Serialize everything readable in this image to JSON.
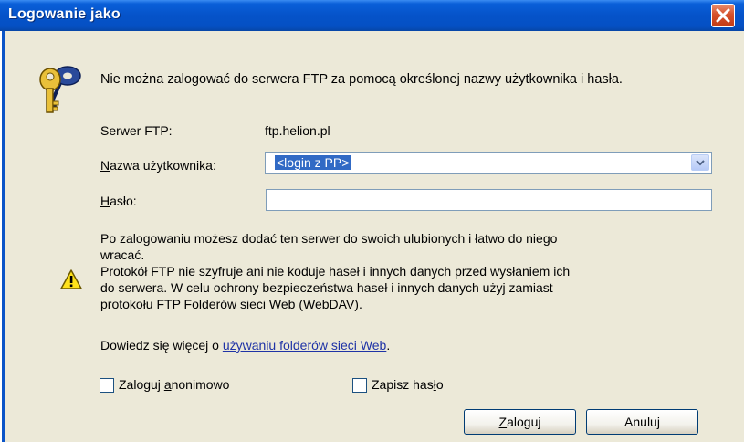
{
  "window": {
    "title": "Logowanie jako"
  },
  "message": "Nie można zalogować do serwera FTP za pomocą określonej nazwy użytkownika i hasła.",
  "server": {
    "label": "Serwer FTP:",
    "value": "ftp.helion.pl"
  },
  "username": {
    "label_pre": "",
    "label_acc": "N",
    "label_post": "azwa użytkownika:",
    "value": "<login z PP>"
  },
  "password": {
    "label_pre": "",
    "label_acc": "H",
    "label_post": "asło:",
    "value": ""
  },
  "info": {
    "line1": "Po zalogowaniu możesz dodać ten serwer do swoich ulubionych i łatwo do niego",
    "line2": "wracać.",
    "line3": "Protokół FTP nie szyfruje ani nie koduje haseł i innych danych przed wysłaniem ich",
    "line4": "do serwera. W celu ochrony bezpieczeństwa haseł i innych danych użyj zamiast",
    "line5": "protokołu FTP Folderów sieci Web (WebDAV)."
  },
  "learn_more": {
    "prefix": "Dowiedz się więcej o ",
    "link": "używaniu folderów sieci Web",
    "suffix": "."
  },
  "anonymous": {
    "pre": "Zaloguj ",
    "acc": "a",
    "post": "nonimowo",
    "checked": false
  },
  "save_password": {
    "pre": "Zapisz has",
    "acc": "ł",
    "post": "o",
    "checked": false
  },
  "buttons": {
    "login": {
      "pre": "",
      "acc": "Z",
      "post": "aloguj"
    },
    "cancel": {
      "label": "Anuluj"
    }
  },
  "icons": {
    "title_close": "close-icon",
    "keys": "keys-icon",
    "warning": "warning-icon",
    "dropdown": "chevron-down-icon"
  },
  "colors": {
    "titlebar": "#0553c9",
    "dialog_bg": "#ece9d8",
    "selection": "#316ac5",
    "link": "#1f33a6"
  }
}
